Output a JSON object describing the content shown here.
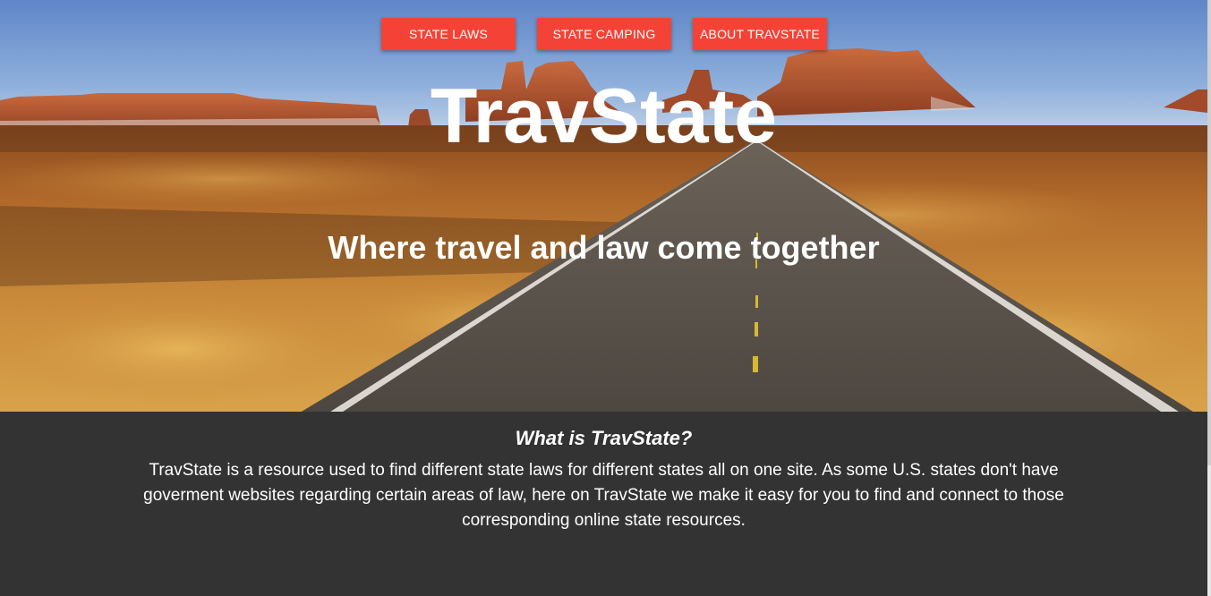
{
  "nav": {
    "items": [
      {
        "label": "STATE LAWS"
      },
      {
        "label": "STATE CAMPING"
      },
      {
        "label": "ABOUT TRAVSTATE"
      }
    ]
  },
  "hero": {
    "title": "TravState",
    "subtitle": "Where travel and law come together",
    "background_description_icon": "desert-road-image"
  },
  "about": {
    "heading": "What is TravState?",
    "body": "TravState is a resource used to find different state laws for different states all on one site. As some U.S. states don't have goverment websites regarding certain areas of law, here on TravState we make it easy for you to find and connect to those corresponding online state resources."
  },
  "colors": {
    "accent": "#f44336",
    "footer_bg": "#333333",
    "text_light": "#ffffff"
  }
}
